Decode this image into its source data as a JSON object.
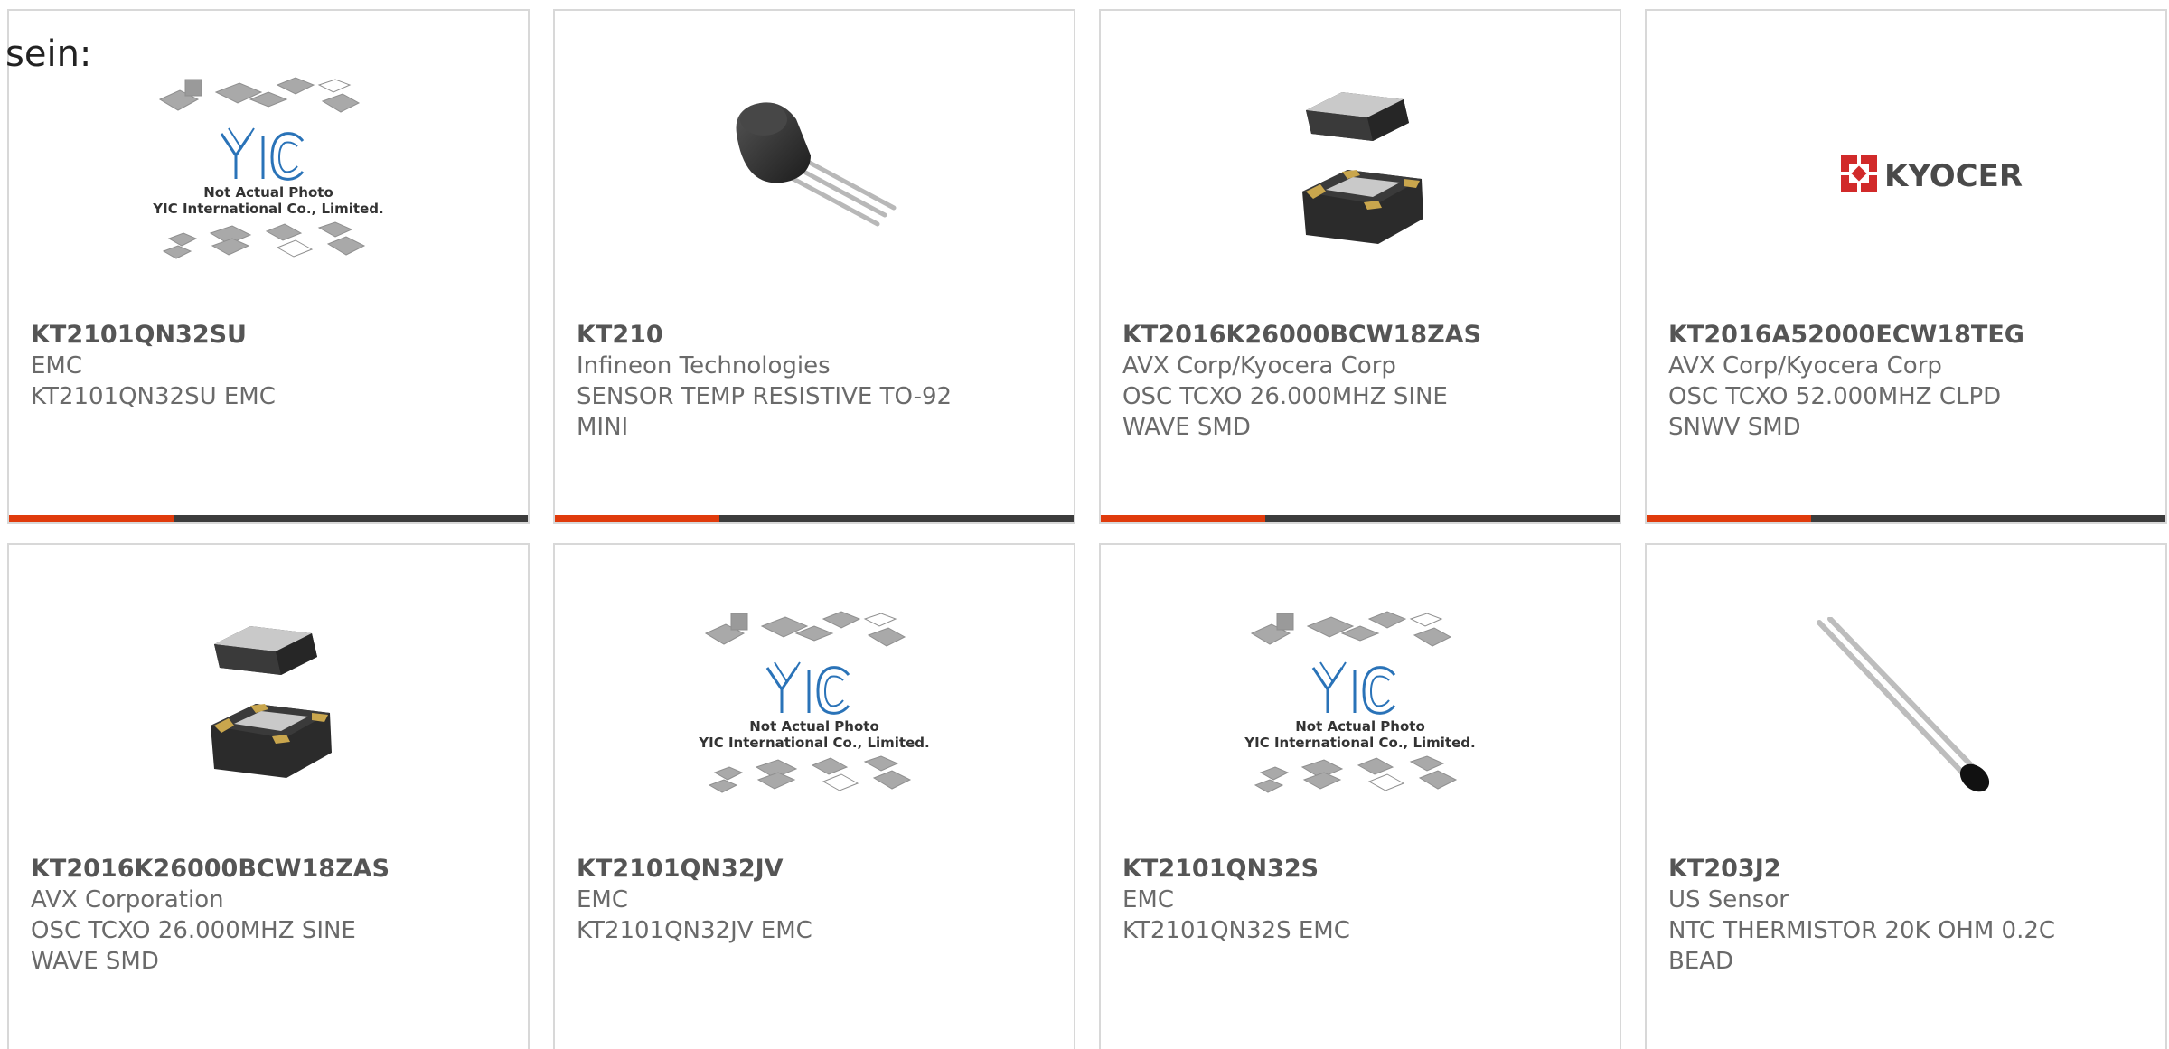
{
  "lead_text": "sein:",
  "colors": {
    "accent": "#e03b0c",
    "bar": "#3c3c3c",
    "border": "#d8d8d8"
  },
  "products": [
    {
      "part_number": "KT2101QN32SU",
      "manufacturer": "EMC",
      "description": "KT2101QN32SU EMC",
      "image": "yic-placeholder",
      "placeholder_caption": [
        "Not Actual Photo",
        "YIC International Co., Limited."
      ]
    },
    {
      "part_number": "KT210",
      "manufacturer": "Infineon Technologies",
      "description": "SENSOR TEMP RESISTIVE TO-92 MINI",
      "image": "to92-transistor"
    },
    {
      "part_number": "KT2016K26000BCW18ZAS",
      "manufacturer": "AVX Corp/Kyocera Corp",
      "description": "OSC TCXO 26.000MHZ SINE WAVE SMD",
      "image": "smd-oscillator"
    },
    {
      "part_number": "KT2016A52000ECW18TEG",
      "manufacturer": "AVX Corp/Kyocera Corp",
      "description": "OSC TCXO 52.000MHZ CLPD SNWV SMD",
      "image": "kyocera-logo",
      "logo_text": "KYOCERA"
    },
    {
      "part_number": "KT2016K26000BCW18ZAS",
      "manufacturer": "AVX Corporation",
      "description": "OSC TCXO 26.000MHZ SINE WAVE SMD",
      "image": "smd-oscillator"
    },
    {
      "part_number": "KT2101QN32JV",
      "manufacturer": "EMC",
      "description": "KT2101QN32JV EMC",
      "image": "yic-placeholder",
      "placeholder_caption": [
        "Not Actual Photo",
        "YIC International Co., Limited."
      ]
    },
    {
      "part_number": "KT2101QN32S",
      "manufacturer": "EMC",
      "description": "KT2101QN32S EMC",
      "image": "yic-placeholder",
      "placeholder_caption": [
        "Not Actual Photo",
        "YIC International Co., Limited."
      ]
    },
    {
      "part_number": "KT203J2",
      "manufacturer": "US Sensor",
      "description": "NTC THERMISTOR 20K OHM 0.2C BEAD",
      "image": "ntc-thermistor"
    }
  ]
}
